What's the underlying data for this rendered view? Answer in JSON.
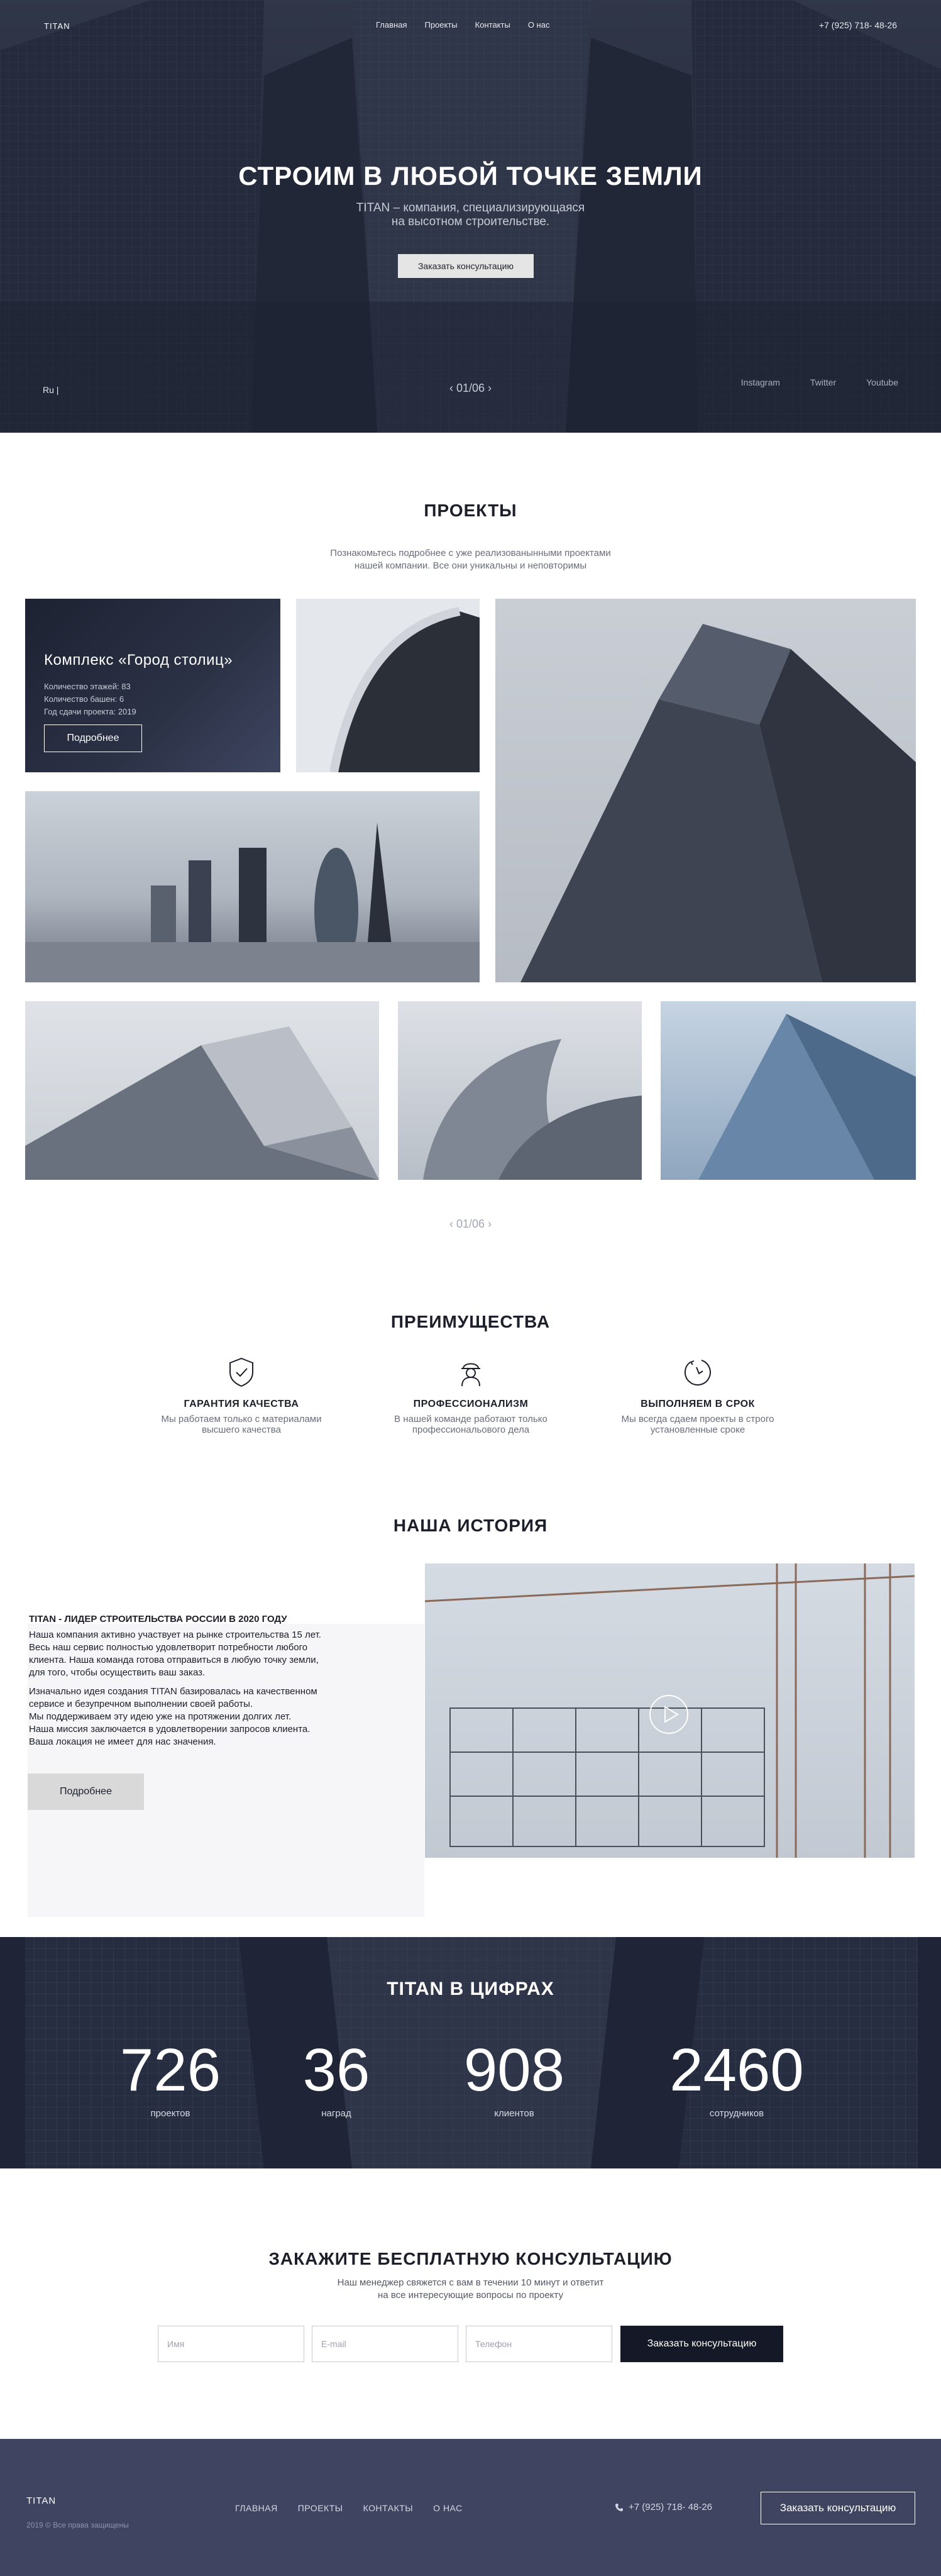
{
  "header": {
    "logo": "TITAN",
    "menu": [
      "Главная",
      "Проекты",
      "Контакты",
      "О нас"
    ],
    "phone": "+7 (925) 718- 48-26"
  },
  "hero": {
    "title": "СТРОИМ В ЛЮБОЙ ТОЧКЕ ЗЕМЛИ",
    "subtitle_line1": "TITAN – компания, специализирующаяся",
    "subtitle_line2": "на высотном строительстве.",
    "cta": "Заказать консультацию",
    "lang": "Ru |",
    "pager": "01/06",
    "social": [
      "Instagram",
      "Twitter",
      "Youtube"
    ]
  },
  "projects": {
    "title": "ПРОЕКТЫ",
    "desc_line1": "Познакомьтесь подробнее с уже реализованынными проектами",
    "desc_line2": "нашей компании. Все они уникальны и неповторимы",
    "feature": {
      "title": "Комплекс «Город столиц»",
      "floors": "Количество этажей: 83",
      "towers": "Количество башен: 6",
      "year": "Год сдачи проекта: 2019",
      "button": "Подробнее"
    },
    "pager": "01/06"
  },
  "advantages": {
    "title": "ПРЕИМУЩЕСТВА",
    "items": [
      {
        "title": "ГАРАНТИЯ КАЧЕСТВА",
        "line1": "Мы работаем только с материалами",
        "line2": "высшего качества",
        "icon": "shield-check-icon"
      },
      {
        "title": "ПРОФЕССИОНАЛИЗМ",
        "line1": "В нашей команде работают только",
        "line2": "профессиональового дела",
        "icon": "worker-icon"
      },
      {
        "title": "ВЫПОЛНЯЕМ В СРОК",
        "line1": "Мы всегда сдаем проекты в строго",
        "line2": "установленные сроке",
        "icon": "clock-icon"
      }
    ]
  },
  "history": {
    "title": "НАША ИСТОРИЯ",
    "heading": "TITAN - ЛИДЕР СТРОИТЕЛЬСТВА РОССИИ В 2020 ГОДУ",
    "p1": [
      "Наша компания активно участвует на рынке строительства 15 лет.",
      "Весь наш сервис полностью удовлетворит потребности любого",
      "клиента. Наша команда готова отправиться в любую точку земли,",
      "для того, чтобы осуществить ваш заказ."
    ],
    "p2": [
      "Изначально идея создания TITAN базировалась на качественном",
      "сервисе и безупречном выполнении своей работы.",
      "Мы поддерживаем эту идею уже на протяжении долгих лет.",
      "Наша миссия заключается в удовлетворении запросов клиента.",
      "Ваша локация не имеет для нас значения."
    ],
    "button": "Подробнее"
  },
  "numbers": {
    "title": "TITAN В ЦИФРАХ",
    "stats": [
      {
        "value": "726",
        "label": "проектов"
      },
      {
        "value": "36",
        "label": "наград"
      },
      {
        "value": "908",
        "label": "клиентов"
      },
      {
        "value": "2460",
        "label": "сотрудников"
      }
    ]
  },
  "consultation": {
    "title": "ЗАКАЖИТЕ БЕСПЛАТНУЮ КОНСУЛЬТАЦИЮ",
    "desc_line1": "Наш менеджер свяжется с вам в течении 10 минут и ответит",
    "desc_line2": "на все интересующие вопросы по проекту",
    "name_placeholder": "Имя",
    "email_placeholder": "E-mail",
    "phone_placeholder": "Телефон",
    "button": "Заказать консультацию"
  },
  "footer": {
    "logo": "TITAN",
    "copyright": "2019 © Все права защищены",
    "menu": [
      "ГЛАВНАЯ",
      "ПРОЕКТЫ",
      "КОНТАКТЫ",
      "О НАС"
    ],
    "phone": "+7 (925) 718- 48-26",
    "button": "Заказать консультацию"
  }
}
